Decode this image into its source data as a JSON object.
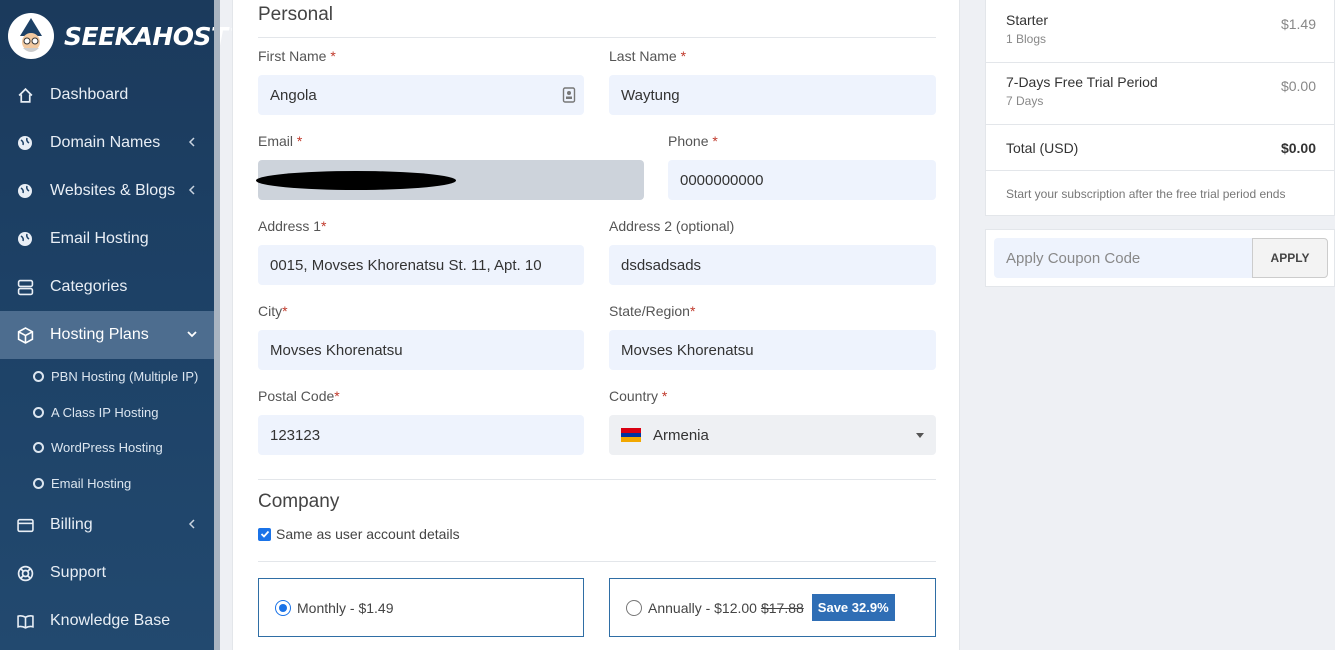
{
  "brand": {
    "name": "SEEKAHOST",
    "tm": "™"
  },
  "sidebar": {
    "items": [
      {
        "label": "Dashboard",
        "icon": "home-icon"
      },
      {
        "label": "Domain Names",
        "icon": "globe-icon"
      },
      {
        "label": "Websites & Blogs",
        "icon": "globe-icon"
      },
      {
        "label": "Email Hosting",
        "icon": "globe-icon"
      },
      {
        "label": "Categories",
        "icon": "server-icon"
      },
      {
        "label": "Hosting Plans",
        "icon": "box-icon"
      },
      {
        "label": "Billing",
        "icon": "card-icon"
      },
      {
        "label": "Support",
        "icon": "lifebuoy-icon"
      },
      {
        "label": "Knowledge Base",
        "icon": "book-icon"
      }
    ],
    "sub_items": [
      {
        "label": "PBN Hosting (Multiple IP)"
      },
      {
        "label": "A Class IP Hosting"
      },
      {
        "label": "WordPress Hosting"
      },
      {
        "label": "Email Hosting"
      }
    ]
  },
  "form": {
    "personal_title": "Personal",
    "first_name": {
      "label": "First Name",
      "value": "Angola"
    },
    "last_name": {
      "label": "Last Name",
      "value": "Waytung"
    },
    "email": {
      "label": "Email",
      "value": ""
    },
    "phone": {
      "label": "Phone",
      "value": "0000000000"
    },
    "address1": {
      "label": "Address 1",
      "value": "0015, Movses Khorenatsu St. 11, Apt. 10"
    },
    "address2": {
      "label": "Address 2 (optional)",
      "value": "dsdsadsads"
    },
    "city": {
      "label": "City",
      "value": "Movses Khorenatsu"
    },
    "state": {
      "label": "State/Region",
      "value": "Movses Khorenatsu"
    },
    "postal": {
      "label": "Postal Code",
      "value": "123123"
    },
    "country": {
      "label": "Country",
      "value": "Armenia"
    },
    "required_mark": "*",
    "company_title": "Company",
    "same_as_account": "Same as user account details",
    "monthly_label": "Monthly - $1.49",
    "annual_label": "Annually - $12.00",
    "annual_old_price": "$17.88",
    "save_badge": "Save 32.9%"
  },
  "summary": {
    "plan_name": "Starter",
    "plan_sub": "1 Blogs",
    "plan_price": "$1.49",
    "trial_name": "7-Days Free Trial Period",
    "trial_sub": "7 Days",
    "trial_price": "$0.00",
    "total_label": "Total (USD)",
    "total_value": "$0.00",
    "note": "Start your subscription after the free trial period ends"
  },
  "coupon": {
    "placeholder": "Apply Coupon Code",
    "button": "APPLY"
  },
  "colors": {
    "sidebar_bg": "#1d4166",
    "accent": "#2f6eb5",
    "input_bg": "#eef3fd"
  }
}
